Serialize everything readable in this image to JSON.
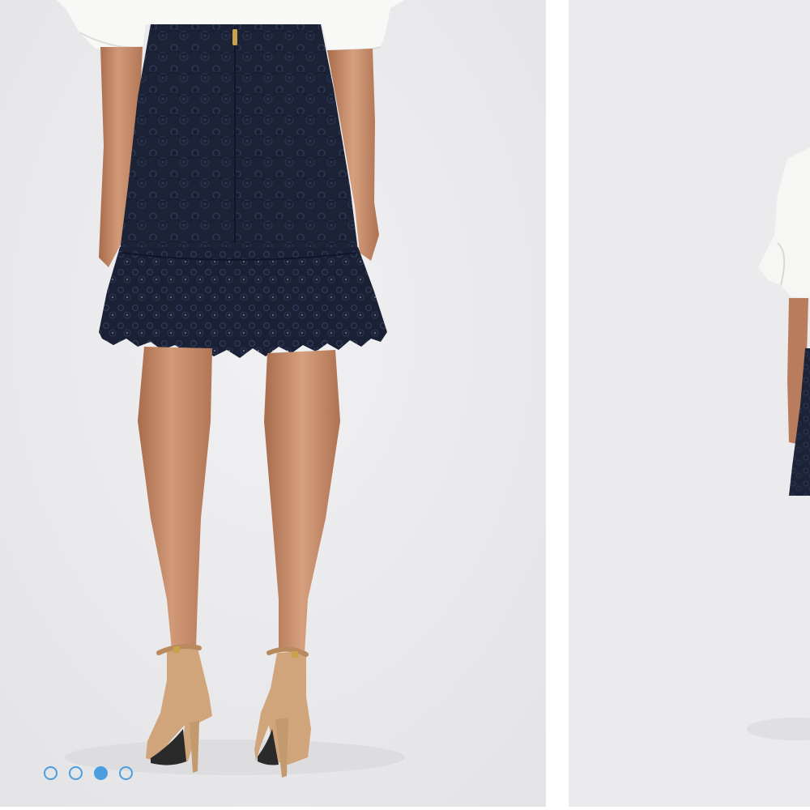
{
  "carousel": {
    "slides": [
      {
        "image": "skirt-back-view-photo",
        "subject": "navy-lace-ruffle-skirt"
      },
      {
        "image": "skirt-side-view-photo",
        "subject": "navy-lace-ruffle-skirt"
      }
    ],
    "pagination": {
      "total": 4,
      "active_index": 2
    }
  },
  "colors": {
    "accent": "#4d9ee0",
    "photo_background": "#ebebed",
    "skirt": "#1b2236",
    "blouse": "#f8f8f6",
    "skin": "#c98f6d",
    "heels": "#d0a57c"
  },
  "icons": {
    "pagination_dot": "circle-outline",
    "pagination_dot_active": "circle-filled"
  }
}
